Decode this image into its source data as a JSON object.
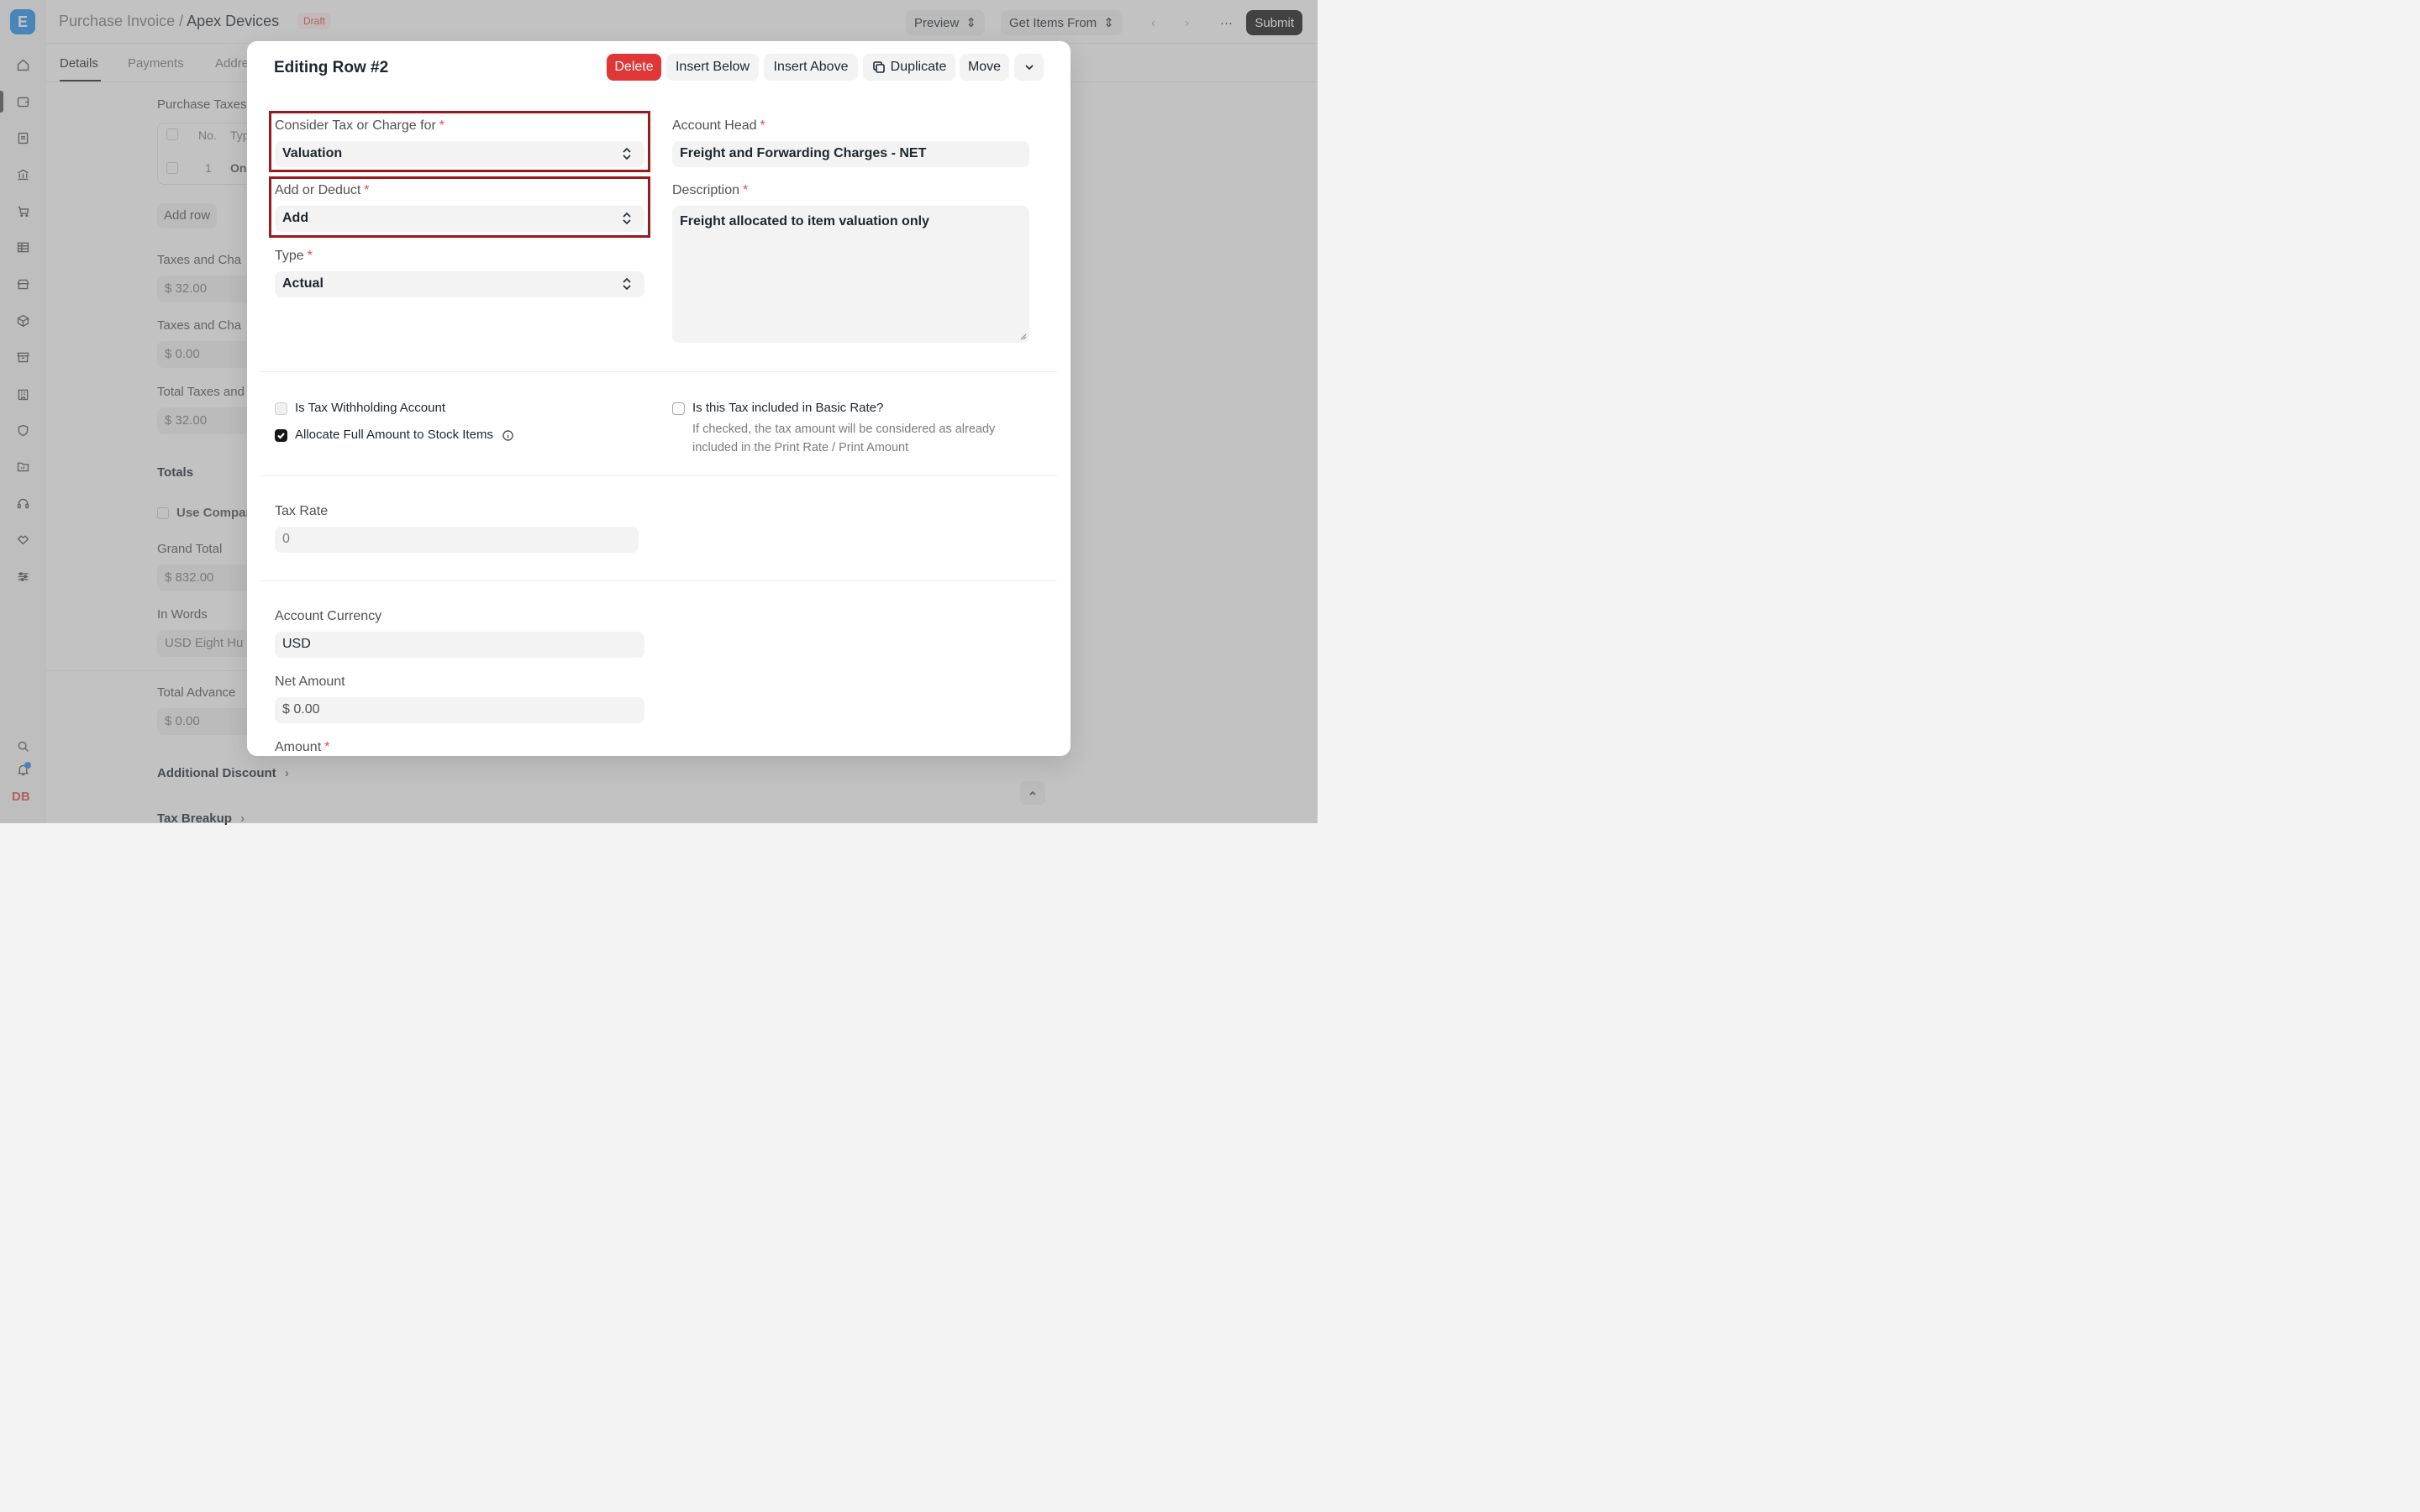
{
  "app": {
    "logo_letter": "E",
    "user_initials": "DB",
    "sidebar_icons": [
      "home-icon",
      "wallet-icon",
      "document-icon",
      "bank-icon",
      "cart-icon",
      "table-icon",
      "store-icon",
      "box-icon",
      "archive-icon",
      "building-icon",
      "shield-icon",
      "folder-chart-icon",
      "headset-icon",
      "handshake-icon",
      "sliders-icon",
      "search-icon",
      "bell-icon"
    ]
  },
  "header": {
    "breadcrumb_parent": "Purchase Invoice",
    "breadcrumb_separator": "/",
    "breadcrumb_current": "Apex Devices",
    "status_badge": "Draft",
    "preview_label": "Preview",
    "get_items_label": "Get Items From",
    "submit_label": "Submit"
  },
  "tabs": [
    "Details",
    "Payments",
    "Addre"
  ],
  "background_form": {
    "taxes_table_label": "Purchase Taxes",
    "table_header_no": "No.",
    "table_header_type": "Typ",
    "table_row_no": "1",
    "table_row_type": "On",
    "add_row_label": "Add row",
    "field1_label": "Taxes and Cha",
    "field1_value": "$ 32.00",
    "field2_label": "Taxes and Cha",
    "field2_value": "$ 0.00",
    "field3_label": "Total Taxes and",
    "field3_value": "$ 32.00",
    "totals_section": "Totals",
    "use_company_label": "Use Compar",
    "grand_total_label": "Grand Total",
    "grand_total_value": "$ 832.00",
    "in_words_label": "In Words",
    "in_words_value": "USD Eight Hu",
    "total_advance_label": "Total Advance",
    "total_advance_value": "$ 0.00",
    "additional_discount_label": "Additional Discount",
    "tax_breakup_label": "Tax Breakup"
  },
  "modal": {
    "title": "Editing Row #2",
    "buttons": {
      "delete": "Delete",
      "insert_below": "Insert Below",
      "insert_above": "Insert Above",
      "duplicate": "Duplicate",
      "move": "Move"
    },
    "fields": {
      "consider_tax_label": "Consider Tax or Charge for",
      "consider_tax_value": "Valuation",
      "add_deduct_label": "Add or Deduct",
      "add_deduct_value": "Add",
      "type_label": "Type",
      "type_value": "Actual",
      "account_head_label": "Account Head",
      "account_head_value": "Freight and Forwarding Charges - NET",
      "description_label": "Description",
      "description_value": "Freight allocated to item valuation only",
      "required_marker": "*"
    },
    "checkboxes": {
      "withholding_label": "Is Tax Withholding Account",
      "withholding_checked": false,
      "allocate_label": "Allocate Full Amount to Stock Items",
      "allocate_checked": true,
      "included_label": "Is this Tax included in Basic Rate?",
      "included_checked": false,
      "included_help_line1": "If checked, the tax amount will be considered as already",
      "included_help_line2": "included in the Print Rate / Print Amount"
    },
    "tax_rate_label": "Tax Rate",
    "tax_rate_value": "0",
    "account_currency_label": "Account Currency",
    "account_currency_value": "USD",
    "net_amount_label": "Net Amount",
    "net_amount_value": "$ 0.00",
    "amount_label": "Amount",
    "highlight_color": "#9b1b1b"
  }
}
